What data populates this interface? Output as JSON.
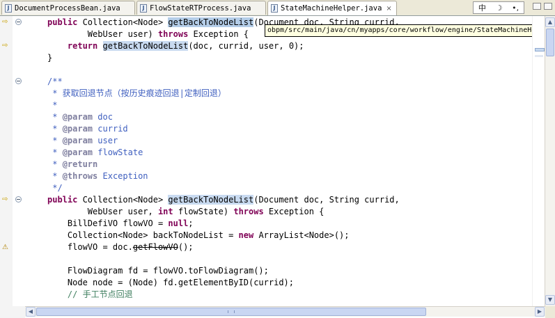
{
  "tabs": [
    {
      "label": "DocumentProcessBean.java",
      "active": false
    },
    {
      "label": "FlowStateRTProcess.java",
      "active": false
    },
    {
      "label": "StateMachineHelper.java",
      "active": true
    }
  ],
  "tab_close_glyph": "×",
  "ime": {
    "lang": "中",
    "moon": "☽",
    "punct": "•,"
  },
  "tooltip": "obpm/src/main/java/cn/myapps/core/workflow/engine/StateMachineHelper.",
  "code": {
    "l1": {
      "a": "public",
      "b": " Collection<Node> ",
      "c": "getBackToNodeList",
      "d": "(Document doc, String currid,"
    },
    "l2": {
      "a": "        WebUser user) ",
      "b": "throws",
      "c": " Exception {"
    },
    "l3": {
      "a": "    ",
      "b": "return",
      "c": " ",
      "d": "getBackToNodeList",
      "e": "(doc, currid, user, 0);"
    },
    "l4": "}",
    "l6": "/**",
    "l7": " * 获取回退节点（按历史痕迹回退|定制回退）",
    "l8": " *",
    "l9": {
      "a": " * ",
      "b": "@param",
      "c": " doc"
    },
    "l10": {
      "a": " * ",
      "b": "@param",
      "c": " currid"
    },
    "l11": {
      "a": " * ",
      "b": "@param",
      "c": " user"
    },
    "l12": {
      "a": " * ",
      "b": "@param",
      "c": " flowState"
    },
    "l13": {
      "a": " * ",
      "b": "@return",
      "c": ""
    },
    "l14": {
      "a": " * ",
      "b": "@throws",
      "c": " Exception"
    },
    "l15": " */",
    "l16": {
      "a": "public",
      "b": " Collection<Node> ",
      "c": "getBackToNodeList",
      "d": "(Document doc, String currid,"
    },
    "l17": {
      "a": "        WebUser user, ",
      "b": "int",
      "c": " flowState) ",
      "d": "throws",
      "e": " Exception {"
    },
    "l18": {
      "a": "    BillDefiVO flowVO = ",
      "b": "null",
      "c": ";"
    },
    "l19": {
      "a": "    Collection<Node> backToNodeList = ",
      "b": "new",
      "c": " ArrayList<Node>();"
    },
    "l20": {
      "a": "    flowVO = doc.",
      "b": "getFlowVO",
      "c": "();"
    },
    "l22": "    FlowDiagram fd = flowVO.toFlowDiagram();",
    "l23": "    Node node = (Node) fd.getElementByID(currid);",
    "l24": "    // 手工节点回退"
  },
  "colors": {
    "keyword": "#7f0055",
    "javadoc": "#3f5fbf",
    "javadoc_tag": "#7f7f9f",
    "line_comment": "#3f7f5f",
    "occurrence_highlight": "#c8daf0",
    "current_line": "#e8f2fe"
  },
  "icons": {
    "tab": "java-file-icon",
    "override_marker": "override-arrow-icon",
    "warning_marker": "warning-icon",
    "fold": "fold-collapse-icon"
  }
}
